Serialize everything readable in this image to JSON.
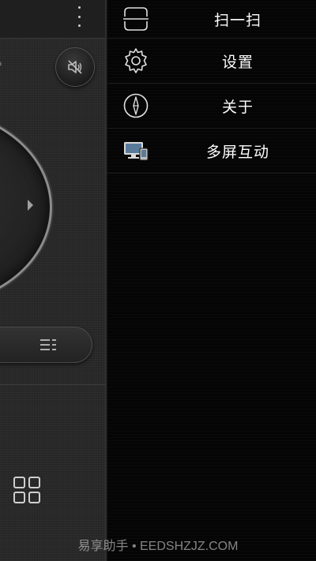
{
  "remote": {
    "icons": {
      "overflow": "more-vertical-icon",
      "mute": "volume-mute-icon",
      "dpad_right": "arrow-right-icon",
      "menu": "menu-list-icon",
      "apps": "apps-grid-icon"
    }
  },
  "drawer": {
    "items": [
      {
        "label": "扫一扫",
        "icon": "scan-icon"
      },
      {
        "label": "设置",
        "icon": "settings-gear-icon"
      },
      {
        "label": "关于",
        "icon": "compass-info-icon"
      },
      {
        "label": "多屏互动",
        "icon": "multi-screen-icon"
      }
    ]
  },
  "watermark": "易享助手 • EEDSHZJZ.COM",
  "colors": {
    "drawer_background": "#050505",
    "remote_background": "#262626",
    "text": "#ffffff"
  }
}
